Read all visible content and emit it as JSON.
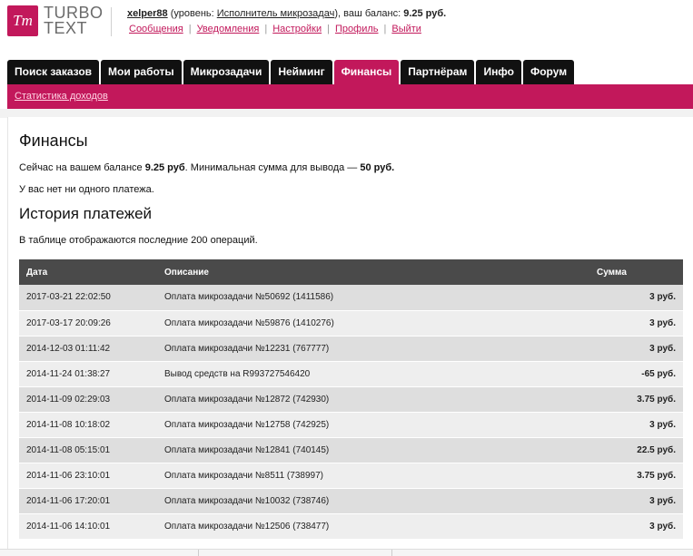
{
  "logo": {
    "mark": "Tт",
    "line1": "TURBO",
    "line2": "TEXT"
  },
  "user": {
    "name": "xelper88",
    "level_prefix": " (уровень: ",
    "level": "Исполнитель микрозадач",
    "balance_prefix": "), ваш баланс: ",
    "balance": "9.25 руб."
  },
  "links": [
    "Сообщения",
    "Уведомления",
    "Настройки",
    "Профиль",
    "Выйти"
  ],
  "tabs": [
    "Поиск заказов",
    "Мои работы",
    "Микрозадачи",
    "Нейминг",
    "Финансы",
    "Партнёрам",
    "Инфо",
    "Форум"
  ],
  "active_tab": "Финансы",
  "subnav": {
    "link": "Статистика доходов"
  },
  "page": {
    "title": "Финансы",
    "balance_text_1": "Сейчас на вашем балансе ",
    "balance_value": "9.25 руб",
    "balance_text_2": ". Минимальная сумма для вывода — ",
    "min_value": "50 руб.",
    "no_payments": "У вас нет ни одного платежа.",
    "history_title": "История платежей",
    "history_note": "В таблице отображаются последние 200 операций."
  },
  "table": {
    "headers": {
      "date": "Дата",
      "desc": "Описание",
      "sum": "Сумма"
    },
    "rows": [
      {
        "date": "2017-03-21 22:02:50",
        "desc": "Оплата микрозадачи №50692 (1411586)",
        "sum": "3 руб."
      },
      {
        "date": "2017-03-17 20:09:26",
        "desc": "Оплата микрозадачи №59876 (1410276)",
        "sum": "3 руб."
      },
      {
        "date": "2014-12-03 01:11:42",
        "desc": "Оплата микрозадачи №12231 (767777)",
        "sum": "3 руб."
      },
      {
        "date": "2014-11-24 01:38:27",
        "desc": "Вывод средств на R993727546420",
        "sum": "-65 руб."
      },
      {
        "date": "2014-11-09 02:29:03",
        "desc": "Оплата микрозадачи №12872 (742930)",
        "sum": "3.75 руб."
      },
      {
        "date": "2014-11-08 10:18:02",
        "desc": "Оплата микрозадачи №12758 (742925)",
        "sum": "3 руб."
      },
      {
        "date": "2014-11-08 05:15:01",
        "desc": "Оплата микрозадачи №12841 (740145)",
        "sum": "22.5 руб."
      },
      {
        "date": "2014-11-06 23:10:01",
        "desc": "Оплата микрозадачи №8511 (738997)",
        "sum": "3.75 руб."
      },
      {
        "date": "2014-11-06 17:20:01",
        "desc": "Оплата микрозадачи №10032 (738746)",
        "sum": "3 руб."
      },
      {
        "date": "2014-11-06 14:10:01",
        "desc": "Оплата микрозадачи №12506 (738477)",
        "sum": "3 руб."
      }
    ]
  },
  "colors": {
    "brand": "#c2185b",
    "tab_bg": "#111111",
    "header_bg": "#4a4a4a"
  }
}
